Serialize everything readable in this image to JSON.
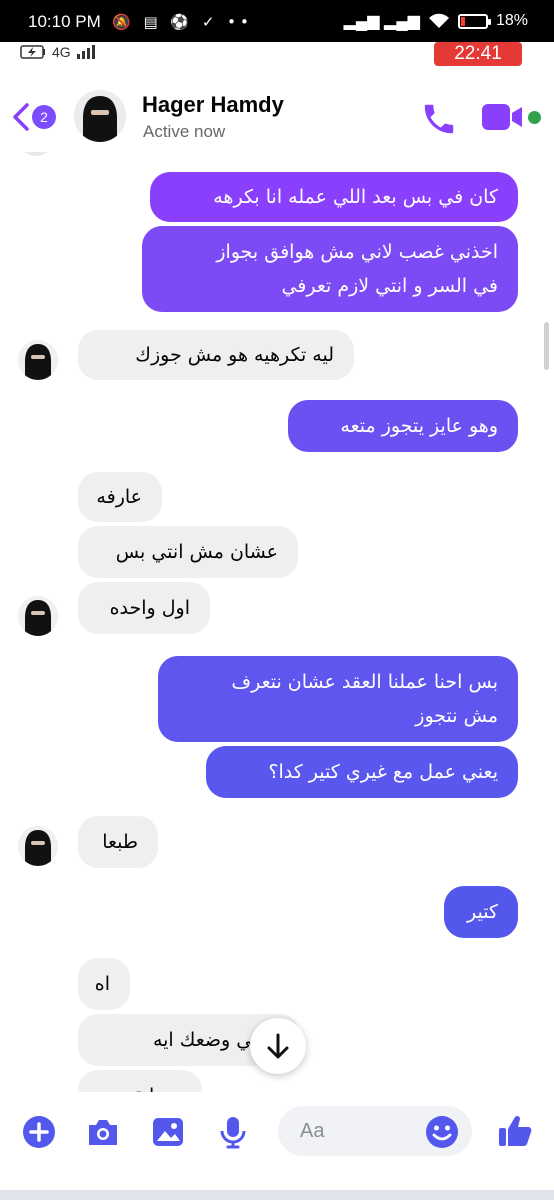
{
  "status_bar": {
    "time": "10:10 PM",
    "left_icons": "🔕 ▤ ⚽ ✓ ••",
    "signal": "▂▄▆ ▂▄▆",
    "battery": "18%",
    "network": "4G",
    "call_timer": "22:41"
  },
  "header": {
    "back_count": "2",
    "name": "Hager Hamdy",
    "status": "Active now"
  },
  "messages": [
    {
      "side": "out",
      "text": "كان في بس بعد اللي عمله انا بكرهه"
    },
    {
      "side": "out",
      "text": "اخذني غصب لاني مش هوافق بجواز\nفي السر و انتي لازم تعرفي"
    },
    {
      "side": "in",
      "text": "ليه تكرهيه هو مش جوزك"
    },
    {
      "side": "out",
      "text": "وهو عايز يتجوز متعه"
    },
    {
      "side": "in",
      "text": "عارفه"
    },
    {
      "side": "in",
      "text": "عشان مش انتي بس"
    },
    {
      "side": "in",
      "text": "اول واحده"
    },
    {
      "side": "out",
      "text": "بس احنا عملنا العقد عشان نتعرف\nمش نتجوز"
    },
    {
      "side": "out",
      "text": "يعني عمل مع غيري كتير كدا؟"
    },
    {
      "side": "in",
      "text": "طبعا"
    },
    {
      "side": "out",
      "text": "كتير"
    },
    {
      "side": "in",
      "text": "اه"
    },
    {
      "side": "in",
      "text": "ـ انتي وضعك ايه"
    },
    {
      "side": "in",
      "text": "حد ابقى"
    }
  ],
  "composer": {
    "placeholder": "Aa"
  },
  "colors": {
    "messenger_purple": "#8a3ffc",
    "messenger_blue": "#5457ec",
    "active_green": "#31a24c",
    "incoming_bubble": "#efeff0",
    "timer_red": "#e53935"
  },
  "icons": [
    "back-icon",
    "phone-icon",
    "video-camera-icon",
    "plus-icon",
    "camera-icon",
    "gallery-icon",
    "microphone-icon",
    "emoji-icon",
    "like-icon",
    "scroll-down-icon"
  ]
}
